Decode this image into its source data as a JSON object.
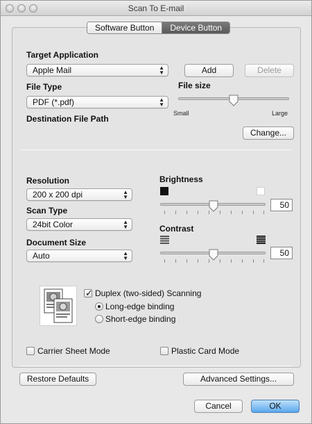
{
  "window": {
    "title": "Scan To E-mail"
  },
  "tabs": {
    "software_label": "Software Button",
    "device_label": "Device Button",
    "selected": "Device Button"
  },
  "target_app": {
    "label": "Target Application",
    "value": "Apple Mail",
    "add_label": "Add",
    "delete_label": "Delete"
  },
  "file_type": {
    "label": "File Type",
    "value": "PDF (*.pdf)"
  },
  "file_size": {
    "label": "File size",
    "min_label": "Small",
    "max_label": "Large",
    "level": 0.5
  },
  "destination": {
    "label": "Destination File Path",
    "change_label": "Change..."
  },
  "resolution": {
    "label": "Resolution",
    "value": "200 x 200 dpi"
  },
  "scan_type": {
    "label": "Scan Type",
    "value": "24bit Color"
  },
  "document_size": {
    "label": "Document Size",
    "value": "Auto"
  },
  "brightness": {
    "label": "Brightness",
    "value": "50"
  },
  "contrast": {
    "label": "Contrast",
    "value": "50"
  },
  "duplex": {
    "label": "Duplex (two-sided) Scanning",
    "checked": true,
    "long_edge_label": "Long-edge binding",
    "short_edge_label": "Short-edge binding",
    "selected": "Long-edge binding"
  },
  "carrier_sheet": {
    "label": "Carrier Sheet Mode",
    "checked": false
  },
  "plastic_card": {
    "label": "Plastic Card Mode",
    "checked": false
  },
  "buttons": {
    "restore_defaults": "Restore Defaults",
    "advanced_settings": "Advanced Settings...",
    "cancel": "Cancel",
    "ok": "OK"
  },
  "colors": {
    "accent": "#5aa7ec",
    "selected_tab": "#666666"
  }
}
